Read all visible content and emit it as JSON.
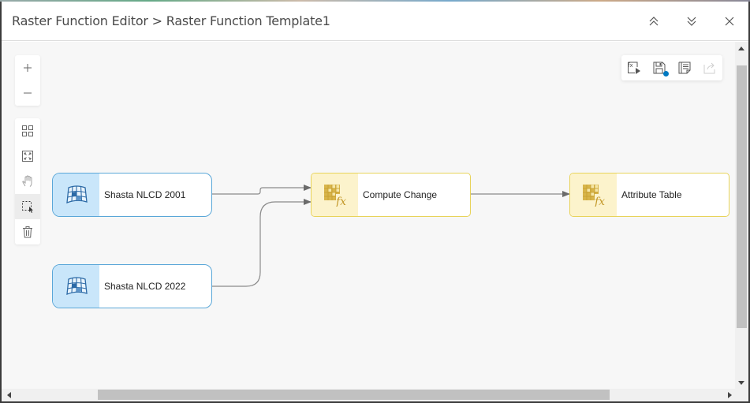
{
  "window": {
    "title": "Raster Function Editor > Raster Function Template1",
    "controls": [
      {
        "name": "collapse-up",
        "icon": "double-chevron-up-icon"
      },
      {
        "name": "collapse-down",
        "icon": "double-chevron-down-icon"
      },
      {
        "name": "close",
        "icon": "close-icon"
      }
    ]
  },
  "left_toolbar": {
    "zoom": [
      {
        "name": "zoom-in",
        "icon": "plus-icon",
        "glyph": "+"
      },
      {
        "name": "zoom-out",
        "icon": "minus-icon",
        "glyph": "—"
      }
    ],
    "tools": [
      {
        "name": "auto-layout",
        "icon": "grid-icon"
      },
      {
        "name": "fit-to-window",
        "icon": "fit-screen-icon"
      },
      {
        "name": "pan",
        "icon": "hand-icon"
      },
      {
        "name": "select",
        "icon": "marquee-select-icon",
        "active": true
      },
      {
        "name": "delete",
        "icon": "trash-icon"
      }
    ]
  },
  "right_toolbar": [
    {
      "name": "run-function",
      "icon": "fx-play-icon"
    },
    {
      "name": "save",
      "icon": "save-icon",
      "badge_color": "#0079c1"
    },
    {
      "name": "properties",
      "icon": "properties-icon"
    },
    {
      "name": "export",
      "icon": "export-icon",
      "disabled": true
    }
  ],
  "nodes": [
    {
      "id": "n1",
      "type": "raster",
      "label": "Shasta NLCD 2001",
      "icon": "raster-dataset-icon"
    },
    {
      "id": "n2",
      "type": "raster",
      "label": "Shasta NLCD 2022",
      "icon": "raster-dataset-icon"
    },
    {
      "id": "n3",
      "type": "function",
      "label": "Compute Change",
      "icon": "raster-function-icon"
    },
    {
      "id": "n4",
      "type": "function",
      "label": "Attribute Table",
      "icon": "raster-function-icon"
    }
  ],
  "links": [
    {
      "from": "n1",
      "to": "n3"
    },
    {
      "from": "n2",
      "to": "n3"
    },
    {
      "from": "n3",
      "to": "n4"
    }
  ],
  "colors": {
    "raster_border": "#5aa7d8",
    "raster_fill": "#c9e6fa",
    "function_border": "#e8d35a",
    "function_fill": "#fcf3cc",
    "link": "#6b6b6b",
    "accent": "#0079c1"
  }
}
